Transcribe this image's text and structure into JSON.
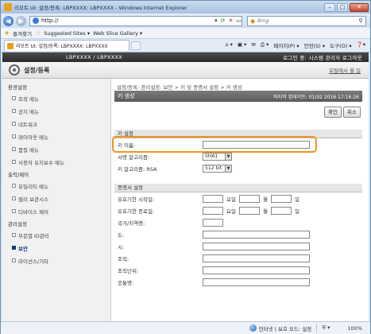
{
  "window": {
    "title": "리모트 UI: 설정/등록: LBPXXXX: LBPXXXX - Windows Internet Explorer",
    "min": "–",
    "max": "□",
    "close": "✕"
  },
  "address": {
    "url": "http://",
    "search_placeholder": "Bing"
  },
  "favbar": {
    "favorites": "즐겨찾기",
    "suggested": "Suggested Sites ▾",
    "gallery": "Web Slice Gallery ▾"
  },
  "tab": {
    "label": "리모트 UI: 설정/등록: LBPXXXX: LBPXXXX"
  },
  "commandbar": {
    "page": "페이지(P) ▾",
    "safety": "안전(S) ▾",
    "tools": "도구(O) ▾",
    "help": "❓▾"
  },
  "product": {
    "name": "LBPXXXX / LBPXXXX",
    "login": "로그인 중: 시스템 관리자 로그아웃"
  },
  "header": {
    "title": "설정/등록",
    "portal": "포털에서 월 일"
  },
  "sidebar": [
    {
      "type": "group",
      "label": "환경설정"
    },
    {
      "type": "item",
      "label": "조작 메뉴"
    },
    {
      "type": "item",
      "label": "공지 메뉴"
    },
    {
      "type": "item",
      "label": "네트워크"
    },
    {
      "type": "item",
      "label": "레이아웃 메뉴"
    },
    {
      "type": "item",
      "label": "품질 메뉴"
    },
    {
      "type": "item",
      "label": "사용자 유지보수 메뉴"
    },
    {
      "type": "group",
      "label": "출력/제어"
    },
    {
      "type": "item",
      "label": "유틸리티 메뉴"
    },
    {
      "type": "item",
      "label": "웹리 보관시스"
    },
    {
      "type": "item",
      "label": "디바이스 제어"
    },
    {
      "type": "group",
      "label": "관리설정"
    },
    {
      "type": "item",
      "label": "부문별 ID관리"
    },
    {
      "type": "item",
      "label": "보안",
      "active": true
    },
    {
      "type": "item",
      "label": "라이선스/기타"
    }
  ],
  "main": {
    "breadcrumb": "설정/등록: 관리설정: 보안 > 키 및 증명서 설정 > 키 생성",
    "section_title": "키 생성",
    "last_update": "마지막 업데이트: 01/02 2016 17:16:26",
    "ok": "확인",
    "cancel": "취소",
    "key_settings": {
      "heading": "키 설정",
      "key_name_label": "키 이름:",
      "key_name_value": "",
      "sig_label": "서명 알고리즘:",
      "sig_value": "SHA1",
      "keyalg_label": "키 알고리즘: RSA",
      "keylen_value": "512 bit"
    },
    "cert_settings": {
      "heading": "증명서 설정",
      "valid_start": "유효기한 시작일:",
      "valid_end": "유효기한 종료일:",
      "year": "요일",
      "month": "월",
      "day": "일",
      "country": "국가/지역명:",
      "state": "도:",
      "city": "시:",
      "org": "조직:",
      "unit": "조직단위:",
      "common": "공통명:"
    }
  },
  "status": {
    "zone": "인터넷 | 보호 모드: 설정",
    "zoom": "100%"
  }
}
